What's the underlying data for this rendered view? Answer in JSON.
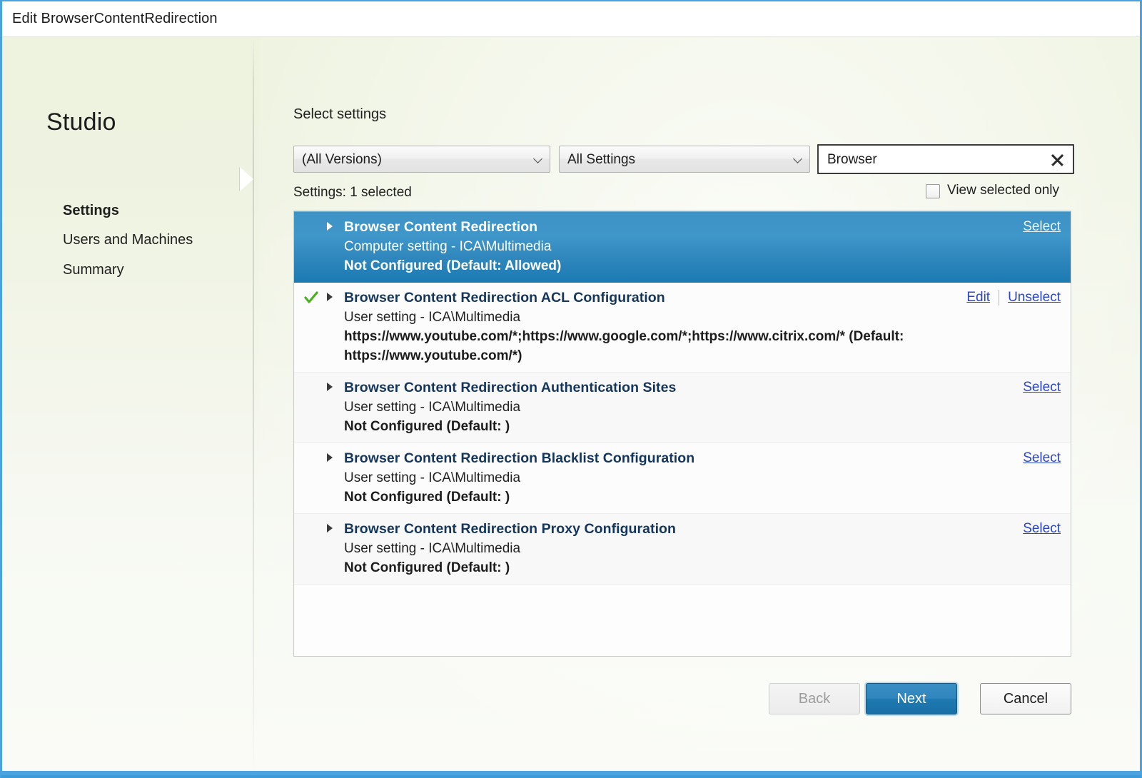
{
  "window": {
    "title": "Edit BrowserContentRedirection",
    "accent_color": "#4aa3df"
  },
  "sidebar": {
    "logo": "Studio",
    "items": [
      {
        "label": "Settings",
        "active": true
      },
      {
        "label": "Users and Machines",
        "active": false
      },
      {
        "label": "Summary",
        "active": false
      }
    ]
  },
  "main": {
    "heading": "Select settings",
    "filters": {
      "version": {
        "value": "(All Versions)"
      },
      "settings_type": {
        "value": "All Settings"
      },
      "search": {
        "value": "Browser",
        "placeholder": "Search settings",
        "clear_icon": "close-icon"
      }
    },
    "count_label": "Settings: 1 selected",
    "view_selected_only": {
      "label": "View selected only",
      "checked": false
    }
  },
  "settings_list": [
    {
      "title": "Browser Content Redirection",
      "scope": "Computer setting - ICA\\Multimedia",
      "value": "Not Configured (Default: Allowed)",
      "selected_row": true,
      "checked": false,
      "actions": [
        "Select"
      ]
    },
    {
      "title": "Browser Content Redirection ACL Configuration",
      "scope": "User setting - ICA\\Multimedia",
      "value": "https://www.youtube.com/*;https://www.google.com/*;https://www.citrix.com/* (Default: https://www.youtube.com/*)",
      "selected_row": false,
      "checked": true,
      "actions": [
        "Edit",
        "Unselect"
      ]
    },
    {
      "title": "Browser Content Redirection Authentication Sites",
      "scope": "User setting - ICA\\Multimedia",
      "value": "Not Configured (Default: )",
      "selected_row": false,
      "checked": false,
      "actions": [
        "Select"
      ]
    },
    {
      "title": "Browser Content Redirection Blacklist Configuration",
      "scope": "User setting - ICA\\Multimedia",
      "value": "Not Configured (Default: )",
      "selected_row": false,
      "checked": false,
      "actions": [
        "Select"
      ]
    },
    {
      "title": "Browser Content Redirection Proxy Configuration",
      "scope": "User setting - ICA\\Multimedia",
      "value": "Not Configured (Default: )",
      "selected_row": false,
      "checked": false,
      "actions": [
        "Select"
      ]
    }
  ],
  "footer": {
    "back": {
      "label": "Back",
      "disabled": true
    },
    "next": {
      "label": "Next",
      "primary": true
    },
    "cancel": {
      "label": "Cancel",
      "disabled": false
    }
  }
}
